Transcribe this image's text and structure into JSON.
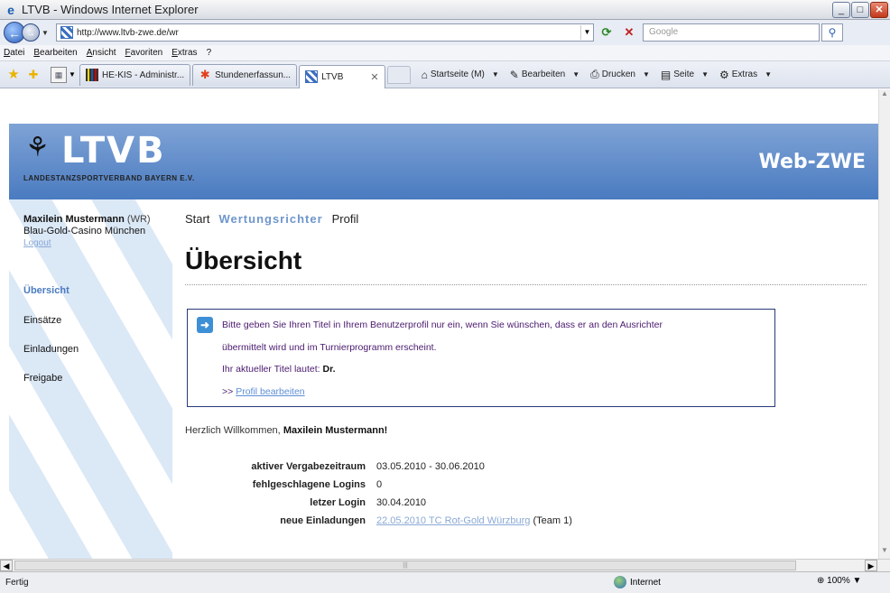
{
  "window": {
    "title": "LTVB - Windows Internet Explorer"
  },
  "address": {
    "url": "http://www.ltvb-zwe.de/wr",
    "search_placeholder": "Google"
  },
  "menu": [
    "Datei",
    "Bearbeiten",
    "Ansicht",
    "Favoriten",
    "Extras",
    "?"
  ],
  "tabs": [
    {
      "label": "HE-KIS - Administr..."
    },
    {
      "label": "Stundenerfassun..."
    },
    {
      "label": "LTVB"
    }
  ],
  "commands": {
    "home": "Startseite (M)",
    "edit": "Bearbeiten",
    "print": "Drucken",
    "page": "Seite",
    "tools": "Extras"
  },
  "header": {
    "logo_text": "LTVB",
    "logo_subtitle": "LANDESTANZSPORTVERBAND BAYERN E.V.",
    "brand": "Web-ZWE"
  },
  "sidebar": {
    "user_name": "Maxilein Mustermann",
    "user_role": "(WR)",
    "club": "Blau-Gold-Casino München",
    "logout": "Logout",
    "items": [
      "Übersicht",
      "Einsätze",
      "Einladungen",
      "Freigabe"
    ]
  },
  "topnav": [
    "Start",
    "Wertungsrichter",
    "Profil"
  ],
  "main": {
    "title": "Übersicht",
    "info_line1": "Bitte geben Sie Ihren Titel in Ihrem Benutzerprofil nur ein, wenn Sie wünschen, dass er an den Ausrichter",
    "info_line2": "übermittelt wird und im Turnierprogramm erscheint.",
    "info_line3_prefix": "Ihr aktueller Titel lautet:",
    "info_line3_value": "Dr.",
    "info_link_prefix": ">>",
    "info_link": "Profil bearbeiten",
    "welcome_prefix": "Herzlich Willkommen,",
    "welcome_name": "Maxilein Mustermann",
    "welcome_suffix": "!",
    "stats": [
      {
        "label": "aktiver Vergabezeitraum",
        "value": "03.05.2010 - 30.06.2010"
      },
      {
        "label": "fehlgeschlagene Logins",
        "value": "0"
      },
      {
        "label": "letzer Login",
        "value": "30.04.2010"
      },
      {
        "label": "neue Einladungen",
        "link": "22.05.2010 TC Rot-Gold Würzburg",
        "suffix": "(Team 1)"
      }
    ]
  },
  "status": {
    "text": "Fertig",
    "zone": "Internet",
    "zoom": "100%"
  },
  "colors": {
    "header_blue": "#4a7bc0",
    "link_blue": "#8aa9d6",
    "info_border": "#283a7a"
  }
}
